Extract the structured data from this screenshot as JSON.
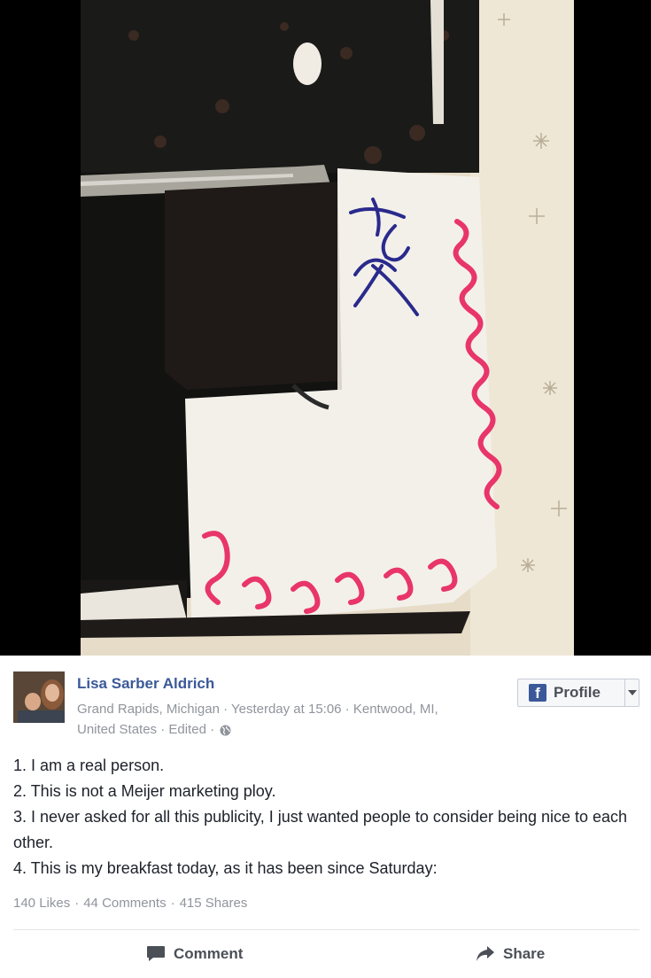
{
  "post": {
    "author": "Lisa Sarber Aldrich",
    "meta_line1": "Grand Rapids, Michigan · Yesterday at 15:06 · Kentwood, MI,",
    "meta_line2": "United States · Edited ·",
    "privacy_icon": "globe-icon",
    "profile_button_label": "Profile",
    "profile_button_icon": "facebook-icon",
    "body": [
      "1. I am a real person.",
      "2. This is not a Meijer marketing ploy.",
      "3. I never asked for all this publicity, I just wanted people to consider being nice to each other.",
      "4. This is my breakfast today, as it has been since Saturday:"
    ],
    "stats": {
      "likes": "140 Likes",
      "comments": "44 Comments",
      "shares": "415 Shares"
    },
    "actions": {
      "comment_label": "Comment",
      "share_label": "Share"
    },
    "colors": {
      "link_blue": "#3b5998",
      "meta_gray": "#90949c",
      "frosting_pink": "#e8356a",
      "writing_blue": "#2a2a8c"
    }
  }
}
